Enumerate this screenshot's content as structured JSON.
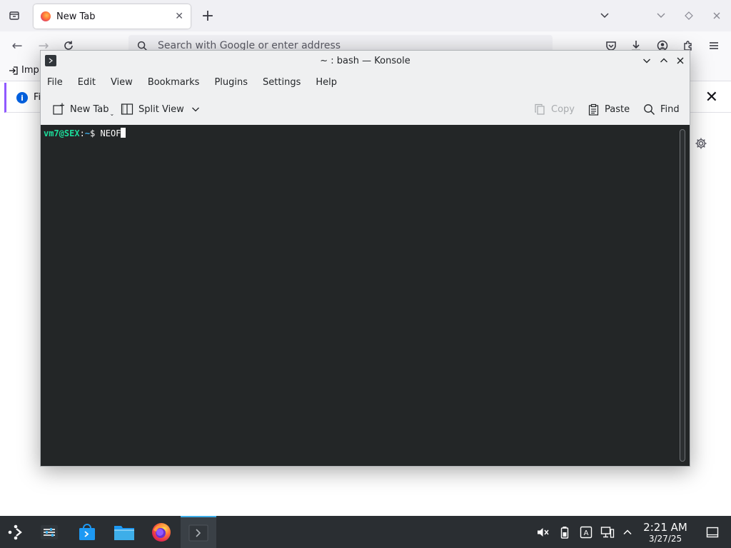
{
  "firefox": {
    "tab": {
      "title": "New Tab"
    },
    "urlbar": {
      "placeholder": "Search with Google or enter address"
    },
    "bookmarks": {
      "import_label": "Imp"
    },
    "notification": {
      "text_fragment": "Fi"
    }
  },
  "konsole": {
    "title": "~ : bash — Konsole",
    "menu": [
      "File",
      "Edit",
      "View",
      "Bookmarks",
      "Plugins",
      "Settings",
      "Help"
    ],
    "toolbar": {
      "new_tab": "New Tab",
      "split_view": "Split View",
      "copy": "Copy",
      "paste": "Paste",
      "find": "Find"
    },
    "terminal": {
      "user_host": "vm7@SEX",
      "separator": ":",
      "path": "~",
      "prompt": "$ ",
      "command": "NEOF"
    }
  },
  "taskbar": {
    "time": "2:21 AM",
    "date": "3/27/25"
  },
  "colors": {
    "terminal_bg": "#232627",
    "prompt_user": "#1cdc9a",
    "prompt_path": "#3daee9",
    "taskbar_bg": "#2a2e32",
    "accent": "#3daee9"
  }
}
